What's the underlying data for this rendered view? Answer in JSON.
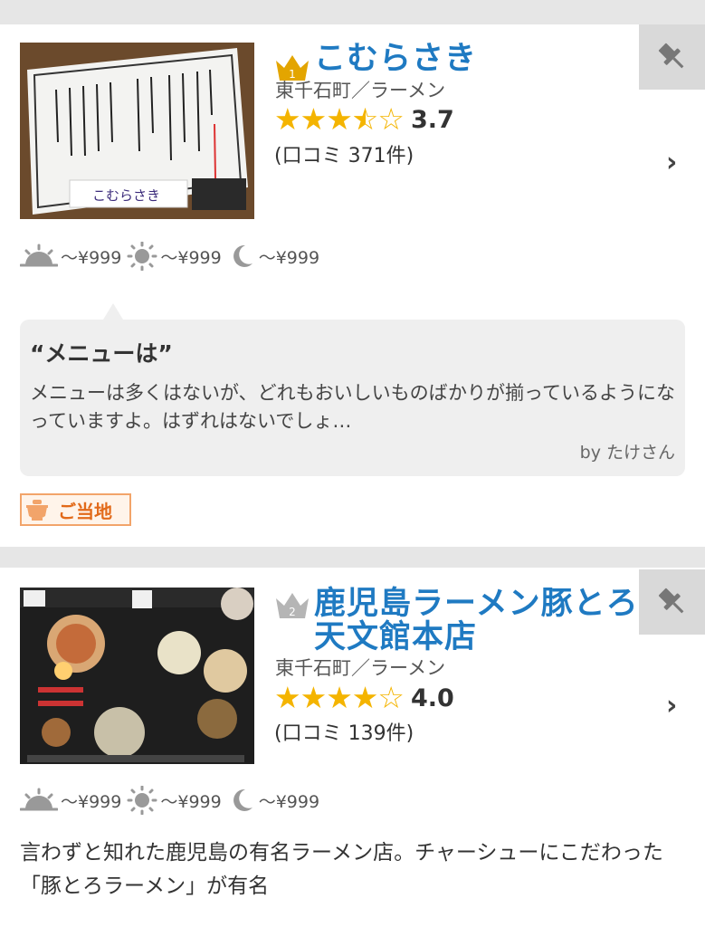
{
  "listings": [
    {
      "rank": "1",
      "name_line1": "こむらさき",
      "name_line2": "",
      "area_genre": "東千石町／ラーメン",
      "rating": "3.7",
      "stars_full": 3,
      "stars_half": 1,
      "stars_empty": 1,
      "reviews": "(口コミ 371件)",
      "prices": {
        "morning": "～¥999",
        "lunch": "～¥999",
        "dinner": "～¥999"
      },
      "review": {
        "title": "“メニューは”",
        "body": "メニューは多くはないが、どれもおいしいものばかりが揃っているようになっていますよ。はずれはないでしょ…",
        "by": "by たけさん"
      },
      "badge": "ご当地",
      "thumb_sign": "こむらさき"
    },
    {
      "rank": "2",
      "name_line1": "鹿児島ラーメン豚とろ",
      "name_line2": "天文館本店",
      "area_genre": "東千石町／ラーメン",
      "rating": "4.0",
      "stars_full": 4,
      "stars_half": 0,
      "stars_empty": 1,
      "reviews": "(口コミ 139件)",
      "prices": {
        "morning": "～¥999",
        "lunch": "～¥999",
        "dinner": "～¥999"
      },
      "description": "言わずと知れた鹿児島の有名ラーメン店。チャーシューにこだわった「豚とろラーメン」が有名"
    }
  ],
  "colors": {
    "accent": "#1f7ac2",
    "star": "#f4b400",
    "gold": "#e3a500",
    "silver": "#b5b5b5",
    "badge": "#e26a1a"
  },
  "icons": {
    "morning": "sunrise-icon",
    "lunch": "sun-icon",
    "dinner": "moon-icon",
    "pin": "pin-icon",
    "chevron": "chevron-right-icon"
  }
}
